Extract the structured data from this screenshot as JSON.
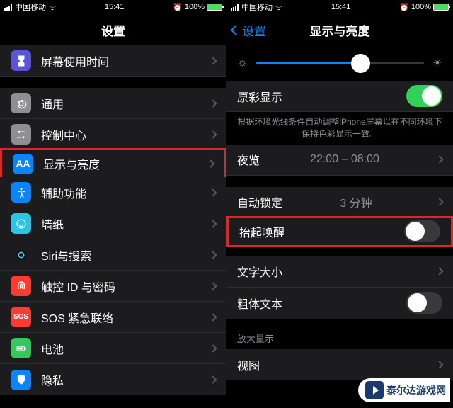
{
  "status": {
    "carrier": "中国移动",
    "time": "15:41",
    "battery": "100%",
    "alarm": "⏰"
  },
  "left": {
    "title": "设置",
    "items": [
      {
        "label": "屏幕使用时间",
        "icon": "hourglass"
      },
      {
        "label": "通用",
        "icon": "gear"
      },
      {
        "label": "控制中心",
        "icon": "ctrl"
      },
      {
        "label": "显示与亮度",
        "icon": "aa",
        "hl": true
      },
      {
        "label": "辅助功能",
        "icon": "access"
      },
      {
        "label": "墙纸",
        "icon": "wall"
      },
      {
        "label": "Siri与搜索",
        "icon": "siri"
      },
      {
        "label": "触控 ID 与密码",
        "icon": "touch"
      },
      {
        "label": "SOS 紧急联络",
        "icon": "sos"
      },
      {
        "label": "电池",
        "icon": "batt"
      },
      {
        "label": "隐私",
        "icon": "priv"
      }
    ]
  },
  "right": {
    "back": "设置",
    "title": "显示与亮度",
    "slider": {
      "value": 62
    },
    "rows": [
      {
        "label": "原彩显示",
        "toggle": "on",
        "footer": "根据环境光线条件自动调整iPhone屏幕以在不同环境下保持色彩显示一致。"
      },
      {
        "label": "夜览",
        "value": "22:00 – 08:00"
      },
      {
        "label": "自动锁定",
        "value": "3 分钟",
        "spacer": true
      },
      {
        "label": "抬起唤醒",
        "toggle": "off",
        "hl": true
      },
      {
        "label": "文字大小",
        "spacer": true
      },
      {
        "label": "粗体文本",
        "toggle": "off"
      }
    ],
    "section": "放大显示",
    "lastRow": "视图"
  },
  "watermark": "泰尔达游戏网"
}
